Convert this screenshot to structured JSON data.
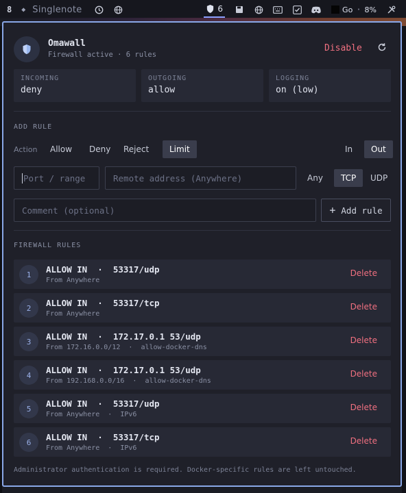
{
  "topbar": {
    "workspace": "8",
    "app_title": "Singlenote",
    "firewall_count": "6",
    "perf_label": "Go",
    "cpu": "8%"
  },
  "header": {
    "name": "Omawall",
    "status": "Firewall active · 6 rules",
    "disable": "Disable"
  },
  "stats": [
    {
      "label": "INCOMING",
      "value": "deny"
    },
    {
      "label": "OUTGOING",
      "value": "allow"
    },
    {
      "label": "LOGGING",
      "value": "on (low)"
    }
  ],
  "add_rule": {
    "heading": "ADD RULE",
    "action_label": "Action",
    "actions": [
      "Allow",
      "Deny",
      "Reject",
      "Limit"
    ],
    "active_action": "Limit",
    "directions": [
      "In",
      "Out"
    ],
    "active_direction": "Out",
    "port_placeholder": "Port / range",
    "address_placeholder": "Remote address (Anywhere)",
    "protocols": [
      "Any",
      "TCP",
      "UDP"
    ],
    "active_protocol": "TCP",
    "comment_placeholder": "Comment (optional)",
    "add_button": "Add rule"
  },
  "rules_heading": "FIREWALL RULES",
  "rules": [
    {
      "num": "1",
      "main": "ALLOW IN  ·  53317/udp",
      "sub": "From Anywhere",
      "delete": "Delete"
    },
    {
      "num": "2",
      "main": "ALLOW IN  ·  53317/tcp",
      "sub": "From Anywhere",
      "delete": "Delete"
    },
    {
      "num": "3",
      "main": "ALLOW IN  ·  172.17.0.1 53/udp",
      "sub": "From 172.16.0.0/12  ·  allow-docker-dns",
      "delete": "Delete"
    },
    {
      "num": "4",
      "main": "ALLOW IN  ·  172.17.0.1 53/udp",
      "sub": "From 192.168.0.0/16  ·  allow-docker-dns",
      "delete": "Delete"
    },
    {
      "num": "5",
      "main": "ALLOW IN  ·  53317/udp",
      "sub": "From Anywhere  ·  IPv6",
      "delete": "Delete"
    },
    {
      "num": "6",
      "main": "ALLOW IN  ·  53317/tcp",
      "sub": "From Anywhere  ·  IPv6",
      "delete": "Delete"
    }
  ],
  "footer": "Administrator authentication is required. Docker-specific rules are left untouched.",
  "colors": {
    "accent": "#8aa8e8",
    "danger": "#f07080",
    "panel": "#1f2029"
  }
}
